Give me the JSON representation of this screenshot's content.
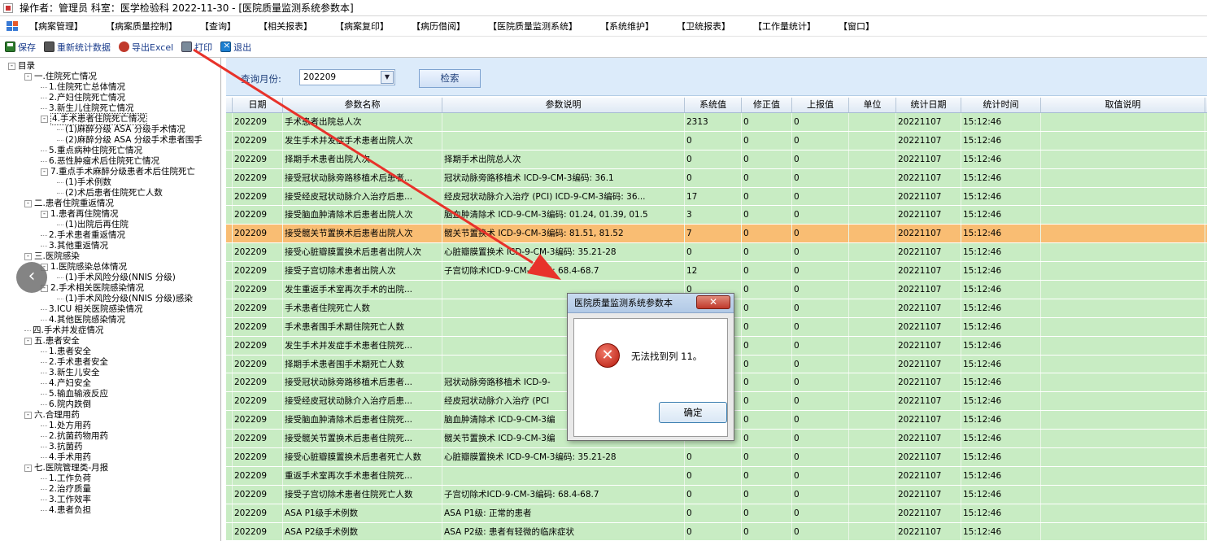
{
  "window": {
    "title": "操作者：管理员 科室：医学检验科 2022-11-30 - [医院质量监测系统参数本]"
  },
  "menu": [
    "【病案管理】",
    "【病案质量控制】",
    "【查询】",
    "【相关报表】",
    "【病案复印】",
    "【病历借阅】",
    "【医院质量监测系统】",
    "【系统维护】",
    "【卫统报表】",
    "【工作量统计】",
    "【窗口】"
  ],
  "toolbar": {
    "save": "保存",
    "recount": "重新统计数据",
    "export": "导出Excel",
    "print": "打印",
    "exit": "退出"
  },
  "tree": [
    {
      "t": "目录",
      "lv": 0,
      "tg": "-"
    },
    {
      "t": "一.住院死亡情况",
      "lv": 1,
      "tg": "-"
    },
    {
      "t": "1.住院死亡总体情况",
      "lv": 2
    },
    {
      "t": "2.产妇住院死亡情况",
      "lv": 2
    },
    {
      "t": "3.新生儿住院死亡情况",
      "lv": 2
    },
    {
      "t": "4.手术患者住院死亡情况",
      "lv": 2,
      "tg": "-",
      "sel": true
    },
    {
      "t": "(1)麻醉分级 ASA 分级手术情况",
      "lv": 3
    },
    {
      "t": "(2)麻醉分级 ASA 分级手术患者围手",
      "lv": 3
    },
    {
      "t": "5.重点病种住院死亡情况",
      "lv": 2
    },
    {
      "t": "6.恶性肿瘤术后住院死亡情况",
      "lv": 2
    },
    {
      "t": "7.重点手术麻醉分级患者术后住院死亡",
      "lv": 2,
      "tg": "-"
    },
    {
      "t": "(1)手术例数",
      "lv": 3
    },
    {
      "t": "(2)术后患者住院死亡人数",
      "lv": 3
    },
    {
      "t": "二.患者住院重返情况",
      "lv": 1,
      "tg": "-"
    },
    {
      "t": "1.患者再住院情况",
      "lv": 2,
      "tg": "-"
    },
    {
      "t": "(1)出院后再住院",
      "lv": 3
    },
    {
      "t": "2.手术患者重返情况",
      "lv": 2
    },
    {
      "t": "3.其他重返情况",
      "lv": 2
    },
    {
      "t": "三.医院感染",
      "lv": 1,
      "tg": "-"
    },
    {
      "t": "1.医院感染总体情况",
      "lv": 2,
      "tg": "-"
    },
    {
      "t": "(1)手术风险分级(NNIS 分级)",
      "lv": 3
    },
    {
      "t": "2.手术相关医院感染情况",
      "lv": 2,
      "tg": "-"
    },
    {
      "t": "(1)手术风险分级(NNIS 分级)感染",
      "lv": 3
    },
    {
      "t": "3.ICU 相关医院感染情况",
      "lv": 2
    },
    {
      "t": "4.其他医院感染情况",
      "lv": 2
    },
    {
      "t": "四.手术并发症情况",
      "lv": 1
    },
    {
      "t": "五.患者安全",
      "lv": 1,
      "tg": "-"
    },
    {
      "t": "1.患者安全",
      "lv": 2
    },
    {
      "t": "2.手术患者安全",
      "lv": 2
    },
    {
      "t": "3.新生儿安全",
      "lv": 2
    },
    {
      "t": "4.产妇安全",
      "lv": 2
    },
    {
      "t": "5.输血输液反应",
      "lv": 2
    },
    {
      "t": "6.院内跌倒",
      "lv": 2
    },
    {
      "t": "六.合理用药",
      "lv": 1,
      "tg": "-"
    },
    {
      "t": "1.处方用药",
      "lv": 2
    },
    {
      "t": "2.抗菌药物用药",
      "lv": 2
    },
    {
      "t": "3.抗菌药",
      "lv": 2
    },
    {
      "t": "4.手术用药",
      "lv": 2
    },
    {
      "t": "七.医院管理类-月报",
      "lv": 1,
      "tg": "-"
    },
    {
      "t": "1.工作负荷",
      "lv": 2
    },
    {
      "t": "2.治疗质量",
      "lv": 2
    },
    {
      "t": "3.工作效率",
      "lv": 2
    },
    {
      "t": "4.患者负担",
      "lv": 2
    }
  ],
  "filter": {
    "label": "查询月份:",
    "value": "202209",
    "search": "检索"
  },
  "columns": [
    "日期",
    "参数名称",
    "参数说明",
    "系统值",
    "修正值",
    "上报值",
    "单位",
    "统计日期",
    "统计时间",
    "取值说明"
  ],
  "rows": [
    [
      "202209",
      "手术患者出院总人次",
      "",
      "2313",
      "0",
      "0",
      "",
      "20221107",
      "15:12:46",
      ""
    ],
    [
      "202209",
      "发生手术并发症手术患者出院人次",
      "",
      "0",
      "0",
      "0",
      "",
      "20221107",
      "15:12:46",
      ""
    ],
    [
      "202209",
      "择期手术患者出院人次",
      "择期手术出院总人次",
      "0",
      "0",
      "0",
      "",
      "20221107",
      "15:12:46",
      ""
    ],
    [
      "202209",
      "接受冠状动脉旁路移植术后患者...",
      "冠状动脉旁路移植术 ICD-9-CM-3编码: 36.1",
      "0",
      "0",
      "0",
      "",
      "20221107",
      "15:12:46",
      ""
    ],
    [
      "202209",
      "接受经皮冠状动脉介入治疗后患...",
      "经皮冠状动脉介入治疗 (PCI) ICD-9-CM-3编码: 36...",
      "17",
      "0",
      "0",
      "",
      "20221107",
      "15:12:46",
      ""
    ],
    [
      "202209",
      "接受脑血肿清除术后患者出院人次",
      "脑血肿清除术 ICD-9-CM-3编码: 01.24, 01.39, 01.5",
      "3",
      "0",
      "0",
      "",
      "20221107",
      "15:12:46",
      ""
    ],
    [
      "202209",
      "接受髋关节置换术后患者出院人次",
      "髋关节置换术 ICD-9-CM-3编码: 81.51, 81.52",
      "7",
      "0",
      "0",
      "",
      "20221107",
      "15:12:46",
      ""
    ],
    [
      "202209",
      "接受心脏瓣膜置换术后患者出院人次",
      "心脏瓣膜置换术 ICD-9-CM-3编码: 35.21-28",
      "0",
      "0",
      "0",
      "",
      "20221107",
      "15:12:46",
      ""
    ],
    [
      "202209",
      "接受子宫切除术患者出院人次",
      "子宫切除术ICD-9-CM-3编码: 68.4-68.7",
      "12",
      "0",
      "0",
      "",
      "20221107",
      "15:12:46",
      ""
    ],
    [
      "202209",
      "发生重返手术室再次手术的出院...",
      "",
      "0",
      "0",
      "0",
      "",
      "20221107",
      "15:12:46",
      ""
    ],
    [
      "202209",
      "手术患者住院死亡人数",
      "",
      "",
      "0",
      "0",
      "",
      "20221107",
      "15:12:46",
      ""
    ],
    [
      "202209",
      "手术患者围手术期住院死亡人数",
      "",
      "",
      "0",
      "0",
      "",
      "20221107",
      "15:12:46",
      ""
    ],
    [
      "202209",
      "发生手术并发症手术患者住院死...",
      "",
      "",
      "0",
      "0",
      "",
      "20221107",
      "15:12:46",
      ""
    ],
    [
      "202209",
      "择期手术患者围手术期死亡人数",
      "",
      "",
      "0",
      "0",
      "",
      "20221107",
      "15:12:46",
      ""
    ],
    [
      "202209",
      "接受冠状动脉旁路移植术后患者...",
      "冠状动脉旁路移植术 ICD-9-",
      "",
      "0",
      "0",
      "",
      "20221107",
      "15:12:46",
      ""
    ],
    [
      "202209",
      "接受经皮冠状动脉介入治疗后患...",
      "经皮冠状动脉介入治疗 (PCI",
      "",
      "0",
      "0",
      "",
      "20221107",
      "15:12:46",
      ""
    ],
    [
      "202209",
      "接受脑血肿清除术后患者住院死...",
      "脑血肿清除术 ICD-9-CM-3编",
      "",
      "0",
      "0",
      "",
      "20221107",
      "15:12:46",
      ""
    ],
    [
      "202209",
      "接受髋关节置换术后患者住院死...",
      "髋关节置换术 ICD-9-CM-3编",
      "",
      "0",
      "0",
      "",
      "20221107",
      "15:12:46",
      ""
    ],
    [
      "202209",
      "接受心脏瓣膜置换术后患者死亡人数",
      "心脏瓣膜置换术 ICD-9-CM-3编码: 35.21-28",
      "0",
      "0",
      "0",
      "",
      "20221107",
      "15:12:46",
      ""
    ],
    [
      "202209",
      "重返手术室再次手术患者住院死...",
      "",
      "0",
      "0",
      "0",
      "",
      "20221107",
      "15:12:46",
      ""
    ],
    [
      "202209",
      "接受子宫切除术患者住院死亡人数",
      "子宫切除术ICD-9-CM-3编码: 68.4-68.7",
      "0",
      "0",
      "0",
      "",
      "20221107",
      "15:12:46",
      ""
    ],
    [
      "202209",
      "ASA P1级手术例数",
      "ASA P1级: 正常的患者",
      "0",
      "0",
      "0",
      "",
      "20221107",
      "15:12:46",
      ""
    ],
    [
      "202209",
      "ASA P2级手术例数",
      "ASA P2级: 患者有轻微的临床症状",
      "0",
      "0",
      "0",
      "",
      "20221107",
      "15:12:46",
      ""
    ]
  ],
  "highlight_row": 6,
  "dialog": {
    "title": "医院质量监测系统参数本",
    "message": "无法找到列 11。",
    "ok": "确定"
  },
  "colors": {
    "grid_bg": "#c8ecc3",
    "highlight": "#f9bd73",
    "filter_bg": "#dcebfa",
    "arrow": "#e8322a"
  }
}
